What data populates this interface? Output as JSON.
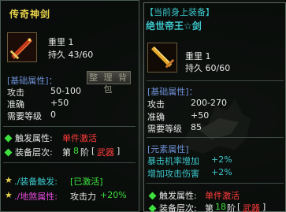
{
  "left": {
    "title": "传奇神剑",
    "stats_header": "[基础属性]：",
    "organize_button": "整 理 背 包",
    "grade_line": "重里 1",
    "durability": "持久 43/60",
    "attributes": [
      {
        "label": "攻击",
        "value": "50-100"
      },
      {
        "label": "准确",
        "value": "+50"
      },
      {
        "label": "需要等级",
        "value": "0"
      }
    ],
    "trigger_label": "触发属性:",
    "trigger_value": "单件激活",
    "layer_label": "装备层次:",
    "layer_prefix": "第",
    "layer_num": "8",
    "layer_suffix": "阶",
    "layer_tag": "武器",
    "set_trigger_label": "./装备触发:",
    "set_trigger_value": "[已激活]",
    "earth_label": "./地煞属性:",
    "earth_attack": "攻击力",
    "earth_value": "+20%"
  },
  "right": {
    "worn_header": "【当前身上装备】",
    "title": "绝世帝王☆剑",
    "grade_line": "重里 1",
    "durability": "持久 60/60",
    "stats_header": "[基础属性]：",
    "attributes": [
      {
        "label": "攻击",
        "value": "200-270"
      },
      {
        "label": "准确",
        "value": "+50"
      },
      {
        "label": "需要等级",
        "value": "85"
      }
    ],
    "element_header": "[元素属性]",
    "element_attributes": [
      {
        "label": "暴击机率增加",
        "value": "+2%"
      },
      {
        "label": "增加攻击伤害",
        "value": "+2%"
      }
    ],
    "trigger_label": "触发属性:",
    "trigger_value": "单件激活",
    "layer_label": "装备层次:",
    "layer_prefix": "第",
    "layer_num": "18",
    "layer_suffix": "阶",
    "layer_tag": "武器"
  },
  "colors": {
    "title_gold": "#e8d24a",
    "section_blue": "#6f8fd6",
    "active_red": "#ff3b3b",
    "activated_green": "#3ee03e",
    "worn_cyan": "#3cc7cc",
    "earth_pink": "#e84adf"
  },
  "icons": [
    "sword-item-icon",
    "golden-sword-item-icon",
    "diamond-bullet-icon",
    "star-icon",
    "mount-silhouette-icon"
  ]
}
